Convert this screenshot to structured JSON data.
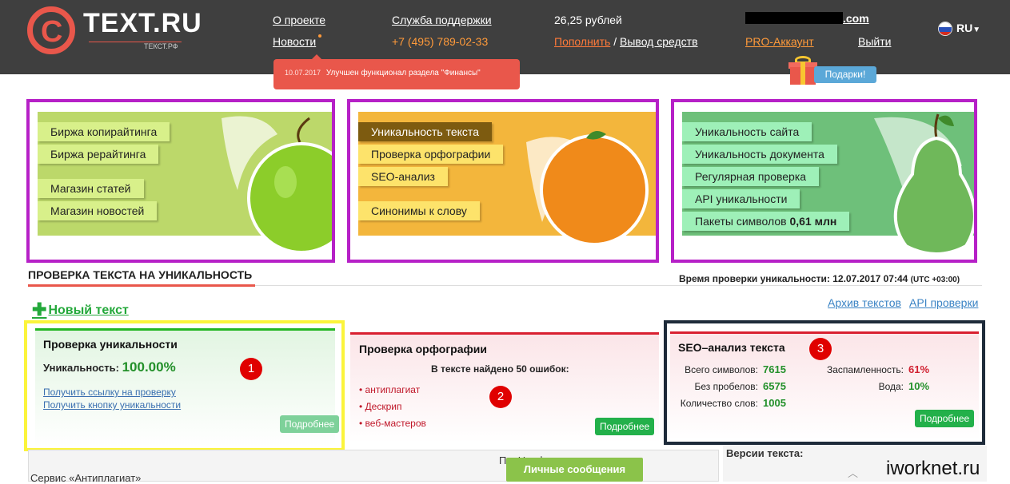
{
  "header": {
    "logo_text": "TEXT.RU",
    "logo_sub": "ТЕКСТ.РФ",
    "about": "О проекте",
    "news": "Новости",
    "support": "Служба поддержки",
    "phone": "+7 (495) 789-02-33",
    "balance": "26,25 рублей",
    "topup": "Пополнить",
    "separator": " / ",
    "withdraw": "Вывод средств",
    "email_suffix": ".com",
    "pro": "PRO-Аккаунт",
    "logout": "Выйти",
    "lang": "RU",
    "news_popup_date": "10.07.2017",
    "news_popup_text": "Улучшен функционал раздела \"Финансы\"",
    "gifts": "Подарки!"
  },
  "banners": {
    "left": [
      "Биржа копирайтинга",
      "Биржа рерайтинга",
      "Магазин статей",
      "Магазин новостей"
    ],
    "middle": [
      "Уникальность текста",
      "Проверка орфографии",
      "SEO-анализ",
      "Синонимы к слову"
    ],
    "right": [
      "Уникальность сайта",
      "Уникальность документа",
      "Регулярная проверка",
      "API уникальности",
      "Пакеты символов"
    ],
    "right_amount": "0,61 млн"
  },
  "section": {
    "title": "ПРОВЕРКА ТЕКСТА НА УНИКАЛЬНОСТЬ",
    "time_label": "Время проверки уникальности: 12.07.2017 07:44",
    "time_zone": "(UTC +03:00)",
    "new_text": "Новый текст",
    "archive": "Архив текстов",
    "api": "API проверки"
  },
  "card_unique": {
    "title": "Проверка уникальности",
    "label": "Уникальность:",
    "value": "100.00%",
    "link1": "Получить ссылку на проверку",
    "link2": "Получить кнопку уникальности",
    "more": "Подробнее",
    "badge": "1"
  },
  "card_spell": {
    "title": "Проверка орфографии",
    "found": "В тексте найдено 50 ошибок:",
    "errors": [
      "антиплагиат",
      "Дескрип",
      "веб-мастеров"
    ],
    "more": "Подробнее",
    "badge": "2"
  },
  "card_seo": {
    "title": "SEO–анализ текста",
    "chars_label": "Всего символов:",
    "chars": "7615",
    "nospace_label": "Без пробелов:",
    "nospace": "6575",
    "words_label": "Количество слов:",
    "words": "1005",
    "spam_label": "Заспамленность:",
    "spam": "61%",
    "water_label": "Вода:",
    "water": "10%",
    "more": "Подробнее",
    "badge": "3"
  },
  "bottom": {
    "service": "Сервис «Антиплагиат»",
    "fragments": "П... Н... фрагменты",
    "messages": "Личные сообщения",
    "versions": "Версии текста:",
    "watermark": "iworknet.ru"
  },
  "colors": {
    "header_bg": "#3f3f3f",
    "brand_red": "#e9574b",
    "banner_border": "#b620c7",
    "green": "#23b04a"
  }
}
